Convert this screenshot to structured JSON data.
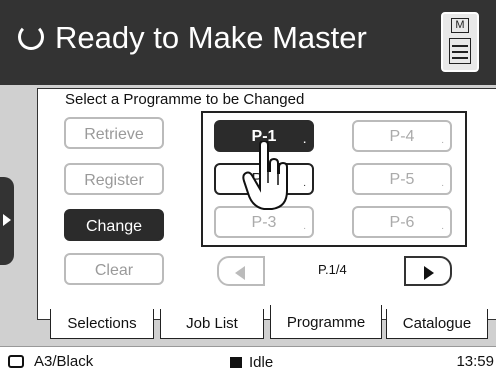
{
  "header": {
    "title": "Ready to Make Master",
    "status_icon": "refresh-ring-icon",
    "master_button_icon": "master-making-icon",
    "master_button_letter": "M"
  },
  "panel": {
    "prompt": "Select a Programme to be Changed",
    "left_buttons": [
      {
        "label": "Retrieve",
        "state": "disabled"
      },
      {
        "label": "Register",
        "state": "disabled"
      },
      {
        "label": "Change",
        "state": "active"
      },
      {
        "label": "Clear",
        "state": "disabled"
      }
    ],
    "programmes": [
      {
        "label": "P-1",
        "mark": "."
      },
      {
        "label": "P-2",
        "mark": "."
      },
      {
        "label": "P-3",
        "mark": "."
      },
      {
        "label": "P-4",
        "mark": "."
      },
      {
        "label": "P-5",
        "mark": "."
      },
      {
        "label": "P-6",
        "mark": "."
      }
    ],
    "page_indicator": "P.1/4"
  },
  "tabs": [
    {
      "label": "Selections"
    },
    {
      "label": "Job List"
    },
    {
      "label": "Programme",
      "active": true
    },
    {
      "label": "Catalogue"
    }
  ],
  "statusbar": {
    "paper": "A3/Black",
    "state": "Idle",
    "time": "13:59"
  },
  "colors": {
    "header_bg": "#333333",
    "active_bg": "#2b2b2b",
    "disabled_text": "#9a9a9a",
    "body_bg": "#d0d0d0"
  }
}
